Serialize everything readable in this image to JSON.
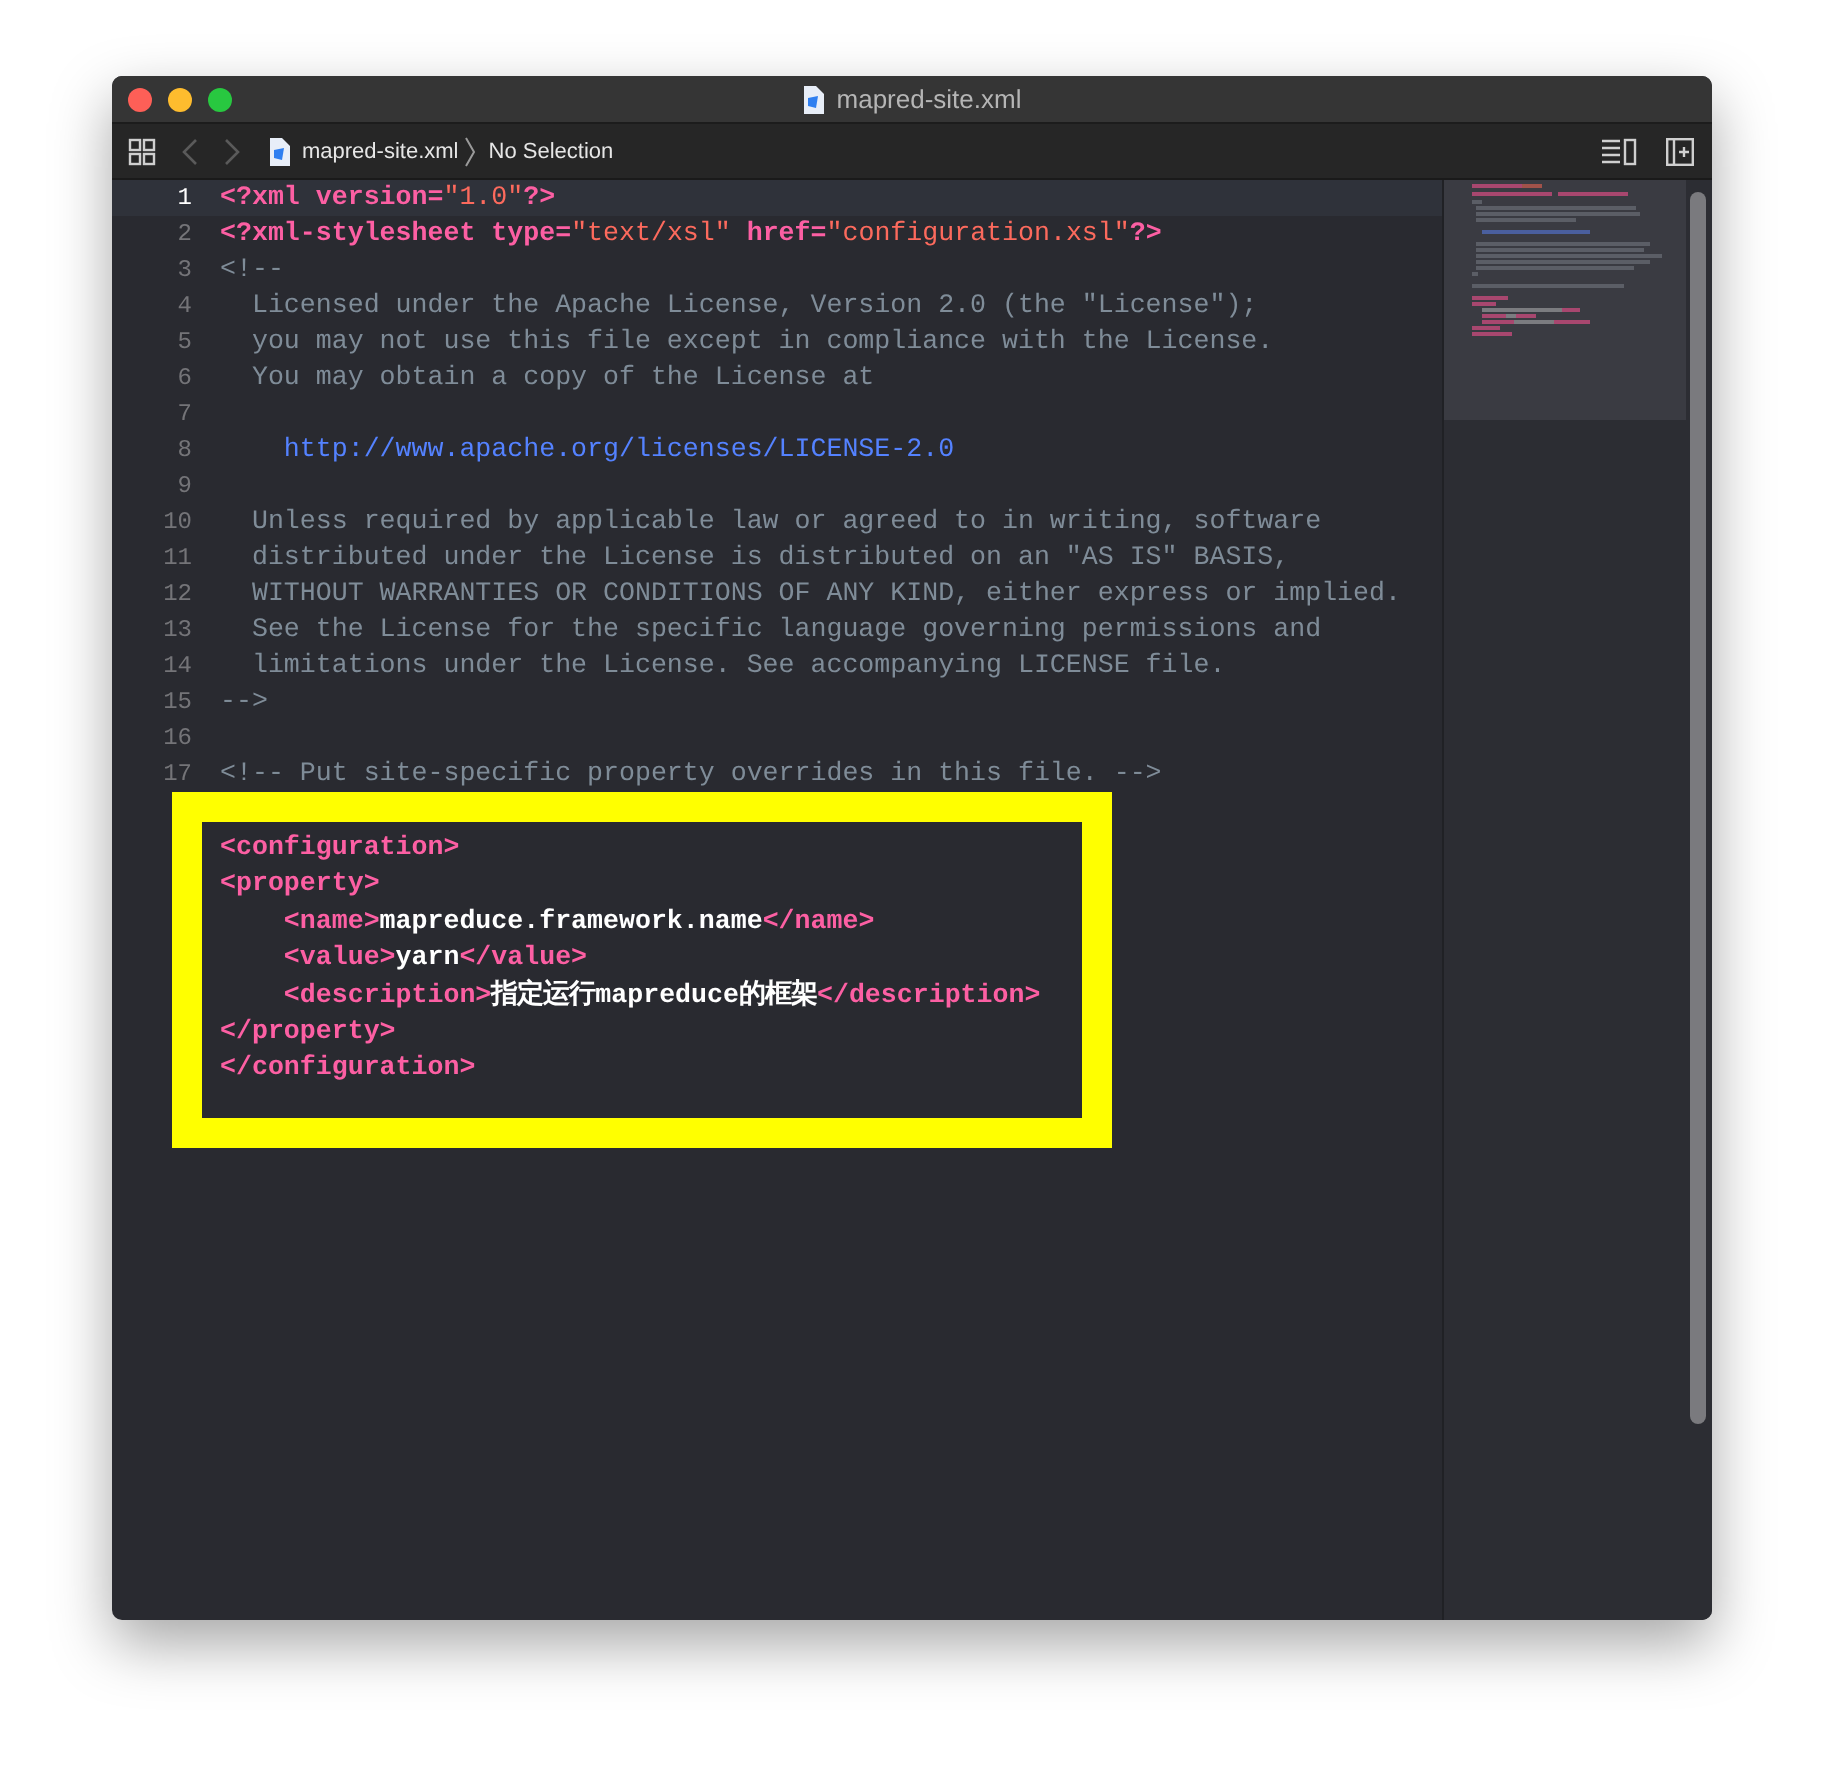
{
  "window": {
    "title": "mapred-site.xml"
  },
  "toolbar": {
    "file": "mapred-site.xml",
    "selection": "No Selection",
    "back_enabled": false,
    "forward_enabled": false
  },
  "editor": {
    "lines": [
      {
        "number": "1",
        "current": true,
        "tokens": [
          {
            "kind": "tag",
            "text": "<?xml version="
          },
          {
            "kind": "string",
            "text": "\"1.0\""
          },
          {
            "kind": "tag",
            "text": "?>"
          }
        ]
      },
      {
        "number": "2",
        "current": false,
        "tokens": [
          {
            "kind": "tag",
            "text": "<?xml-stylesheet type="
          },
          {
            "kind": "string",
            "text": "\"text/xsl\""
          },
          {
            "kind": "tag",
            "text": " href="
          },
          {
            "kind": "string",
            "text": "\"configuration.xsl\""
          },
          {
            "kind": "tag",
            "text": "?>"
          }
        ]
      },
      {
        "number": "3",
        "current": false,
        "tokens": [
          {
            "kind": "comment",
            "text": "<!--"
          }
        ]
      },
      {
        "number": "4",
        "current": false,
        "tokens": [
          {
            "kind": "comment",
            "text": "  Licensed under the Apache License, Version 2.0 (the \"License\");"
          }
        ]
      },
      {
        "number": "5",
        "current": false,
        "tokens": [
          {
            "kind": "comment",
            "text": "  you may not use this file except in compliance with the License."
          }
        ]
      },
      {
        "number": "6",
        "current": false,
        "tokens": [
          {
            "kind": "comment",
            "text": "  You may obtain a copy of the License at"
          }
        ]
      },
      {
        "number": "7",
        "current": false
      },
      {
        "number": "8",
        "current": false,
        "tokens": [
          {
            "kind": "url",
            "text": "    http://www.apache.org/licenses/LICENSE-2.0"
          }
        ]
      },
      {
        "number": "9",
        "current": false
      },
      {
        "number": "10",
        "current": false,
        "tokens": [
          {
            "kind": "comment",
            "text": "  Unless required by applicable law or agreed to in writing, software"
          }
        ]
      },
      {
        "number": "11",
        "current": false,
        "tokens": [
          {
            "kind": "comment",
            "text": "  distributed under the License is distributed on an \"AS IS\" BASIS,"
          }
        ]
      },
      {
        "number": "12",
        "current": false,
        "tokens": [
          {
            "kind": "comment",
            "text": "  WITHOUT WARRANTIES OR CONDITIONS OF ANY KIND, either express or implied."
          }
        ]
      },
      {
        "number": "13",
        "current": false,
        "tokens": [
          {
            "kind": "comment",
            "text": "  See the License for the specific language governing permissions and"
          }
        ]
      },
      {
        "number": "14",
        "current": false,
        "tokens": [
          {
            "kind": "comment",
            "text": "  limitations under the License. See accompanying LICENSE file."
          }
        ]
      },
      {
        "number": "15",
        "current": false,
        "tokens": [
          {
            "kind": "comment",
            "text": "-->"
          }
        ]
      },
      {
        "number": "16",
        "current": false
      },
      {
        "number": "17",
        "current": false,
        "tokens": [
          {
            "kind": "comment",
            "text": "<!-- Put site-specific property overrides in this file. -->"
          }
        ]
      }
    ]
  },
  "highlight": {
    "lines": [
      {
        "tokens": [
          {
            "kind": "tag",
            "text": "<configuration>"
          }
        ]
      },
      {
        "tokens": [
          {
            "kind": "tag",
            "text": "<property>"
          }
        ]
      },
      {
        "tokens": [
          {
            "kind": "tag",
            "text": "    <name>"
          },
          {
            "kind": "text",
            "text": "mapreduce.framework.name"
          },
          {
            "kind": "tag",
            "text": "</name>"
          }
        ]
      },
      {
        "tokens": [
          {
            "kind": "tag",
            "text": "    <value>"
          },
          {
            "kind": "text",
            "text": "yarn"
          },
          {
            "kind": "tag",
            "text": "</value>"
          }
        ]
      },
      {
        "tokens": [
          {
            "kind": "tag",
            "text": "    <description>"
          },
          {
            "kind": "text",
            "text": "指定运行mapreduce的框架"
          },
          {
            "kind": "tag",
            "text": "</description>"
          }
        ]
      },
      {
        "tokens": [
          {
            "kind": "tag",
            "text": "</property>"
          }
        ]
      },
      {
        "tokens": [
          {
            "kind": "tag",
            "text": "</configuration>"
          }
        ]
      }
    ]
  }
}
